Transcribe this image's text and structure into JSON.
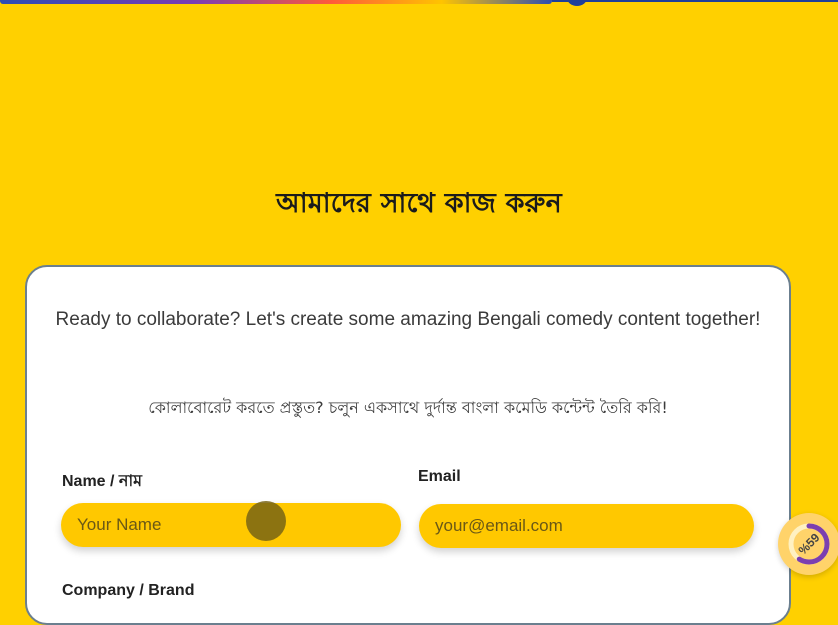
{
  "section": {
    "title": "আমাদের সাথে কাজ করুন"
  },
  "card": {
    "intro_en": "Ready to collaborate? Let's create some amazing Bengali comedy content together!",
    "intro_bn": "কোলাবোরেট করতে প্রস্তুত? চলুন একসাথে দুর্দান্ত বাংলা কমেডি কন্টেন্ট তৈরি করি!"
  },
  "form": {
    "name": {
      "label": "Name / নাম",
      "placeholder": "Your Name",
      "value": ""
    },
    "email": {
      "label": "Email",
      "placeholder": "your@email.com",
      "value": ""
    },
    "company": {
      "label": "Company / Brand"
    }
  },
  "scroll_progress": {
    "text": "%59",
    "value": 0.59
  },
  "colors": {
    "page_background": "#FFD000",
    "input_background": "#FFC800",
    "card_border": "#6b7f8f",
    "progress_ring": "#7b3fb0"
  }
}
